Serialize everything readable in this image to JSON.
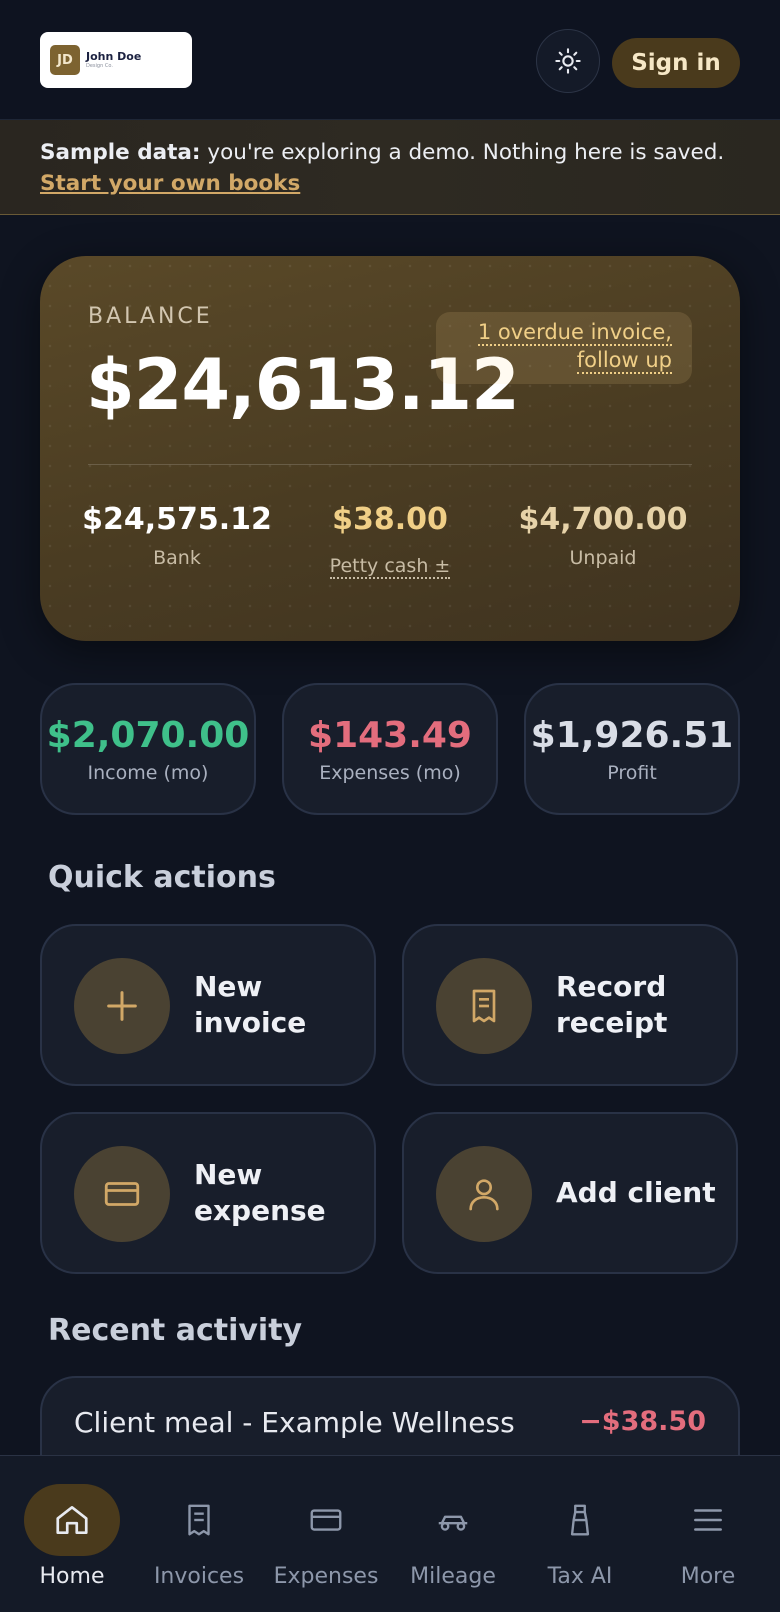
{
  "header": {
    "logo_initials": "JD",
    "logo_name": "John Doe",
    "logo_sub": "Design Co.",
    "theme_toggle": "sun-icon",
    "signin_label": "Sign in"
  },
  "banner": {
    "bold": "Sample data:",
    "text": " you're exploring a demo. Nothing here is saved.",
    "link": "Start your own books"
  },
  "balance": {
    "label": "BALANCE",
    "value": "$24,613.12",
    "overdue_line1": "1 overdue invoice,",
    "overdue_line2": "follow up",
    "bank_value": "$24,575.12",
    "bank_label": "Bank",
    "petty_value": "$38.00",
    "petty_label": "Petty cash ±",
    "unpaid_value": "$4,700.00",
    "unpaid_label": "Unpaid"
  },
  "stats": [
    {
      "value": "$2,070.00",
      "label": "Income (mo)",
      "color": "#3fc08a"
    },
    {
      "value": "$143.49",
      "label": "Expenses (mo)",
      "color": "#e36d7d"
    },
    {
      "value": "$1,926.51",
      "label": "Profit",
      "color": "#d9dde6"
    }
  ],
  "quick_actions": {
    "title": "Quick actions",
    "items": [
      {
        "line1": "New",
        "line2": "invoice",
        "icon": "plus-icon"
      },
      {
        "line1": "Record",
        "line2": "receipt",
        "icon": "receipt-icon"
      },
      {
        "line1": "New",
        "line2": "expense",
        "icon": "credit-card-icon"
      },
      {
        "line1": "Add client",
        "line2": "",
        "icon": "user-icon"
      }
    ]
  },
  "recent": {
    "title": "Recent activity",
    "items": [
      {
        "name": "Client meal - Example Wellness",
        "amount": "−$38.50"
      }
    ]
  },
  "nav": [
    {
      "label": "Home",
      "icon": "home-icon",
      "active": true
    },
    {
      "label": "Invoices",
      "icon": "invoice-icon"
    },
    {
      "label": "Expenses",
      "icon": "credit-card-icon"
    },
    {
      "label": "Mileage",
      "icon": "car-icon"
    },
    {
      "label": "Tax AI",
      "icon": "tax-ai-icon"
    },
    {
      "label": "More",
      "icon": "menu-icon"
    }
  ],
  "colors": {
    "accent": "#d2a867",
    "income": "#3fc08a",
    "expense": "#e36d7d",
    "gold": "#f0cf87"
  }
}
